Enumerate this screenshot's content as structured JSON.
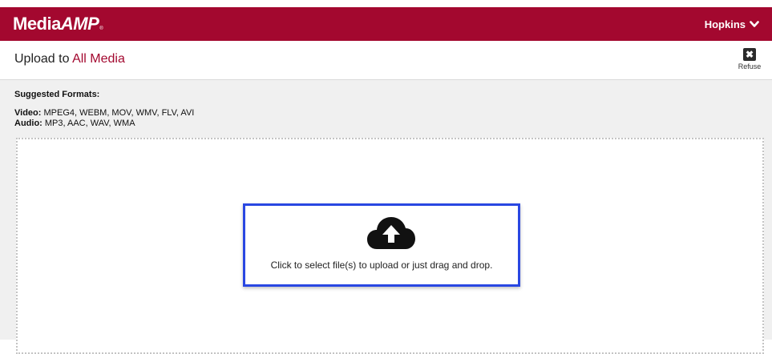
{
  "header": {
    "logo_main": "Media",
    "logo_accent": "AMP",
    "logo_tm": "®",
    "user_name": "Hopkins",
    "brand_color": "#a3082f"
  },
  "titlebar": {
    "prefix": "Upload to ",
    "target": "All Media",
    "refuse_label": "Refuse",
    "refuse_icon": "close-icon"
  },
  "formats": {
    "heading": "Suggested Formats:",
    "video_label": "Video:",
    "video_list": " MPEG4, WEBM, MOV, WMV, FLV, AVI",
    "audio_label": "Audio:",
    "audio_list": " MP3, AAC, WAV, WMA"
  },
  "upload": {
    "icon": "cloud-upload-icon",
    "text": "Click to select file(s) to upload or just drag and drop.",
    "highlight_color": "#2947e2"
  }
}
